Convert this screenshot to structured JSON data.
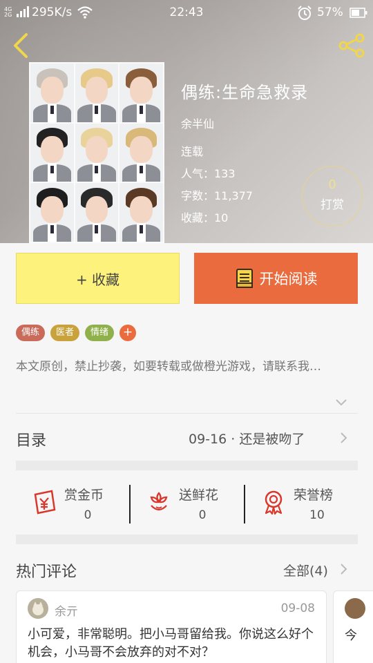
{
  "status_bar": {
    "network_top": "4G",
    "network_bottom": "2G",
    "speed": "295K/s",
    "time": "22:43",
    "battery": "57%"
  },
  "icons": {
    "back": "back-chevron-icon",
    "share": "share-icon",
    "read": "book-icon",
    "gold": "red-envelope-icon",
    "flower": "flower-icon",
    "honor": "medal-icon"
  },
  "book": {
    "title": "偶练:生命急救录",
    "author": "余半仙",
    "status": "连载",
    "popularity": "人气：133",
    "word_count": "字数：11,377",
    "favorites": "收藏：10"
  },
  "tip": {
    "count": "0",
    "label": "打赏"
  },
  "actions": {
    "collect": "+ 收藏",
    "read": "开始阅读"
  },
  "tags": [
    {
      "label": "偶练",
      "color": "#c96a5a"
    },
    {
      "label": "医者",
      "color": "#c9a23c"
    },
    {
      "label": "情绪",
      "color": "#8fb04a"
    }
  ],
  "tag_add": "+",
  "description": "本文原创，禁止抄袭，如要转载或做橙光游戏，请联系我…",
  "toc": {
    "label": "目录",
    "latest": "09-16 · 还是被吻了"
  },
  "stats": [
    {
      "label": "赏金币",
      "value": "0"
    },
    {
      "label": "送鲜花",
      "value": "0"
    },
    {
      "label": "荣誉榜",
      "value": "10"
    }
  ],
  "hot_comments": {
    "label": "热门评论",
    "all": "全部(4)",
    "items": [
      {
        "user": "余亓",
        "date": "09-08",
        "text": "小可爱，非常聪明。把小马哥留给我。你说这么好个机会，小马哥不会放弃的对不对？"
      },
      {
        "text": "今"
      }
    ]
  },
  "colors": {
    "accent_orange": "#ea6b3e",
    "collect_yellow": "#fdf27c",
    "red_icon": "#d9372b"
  }
}
